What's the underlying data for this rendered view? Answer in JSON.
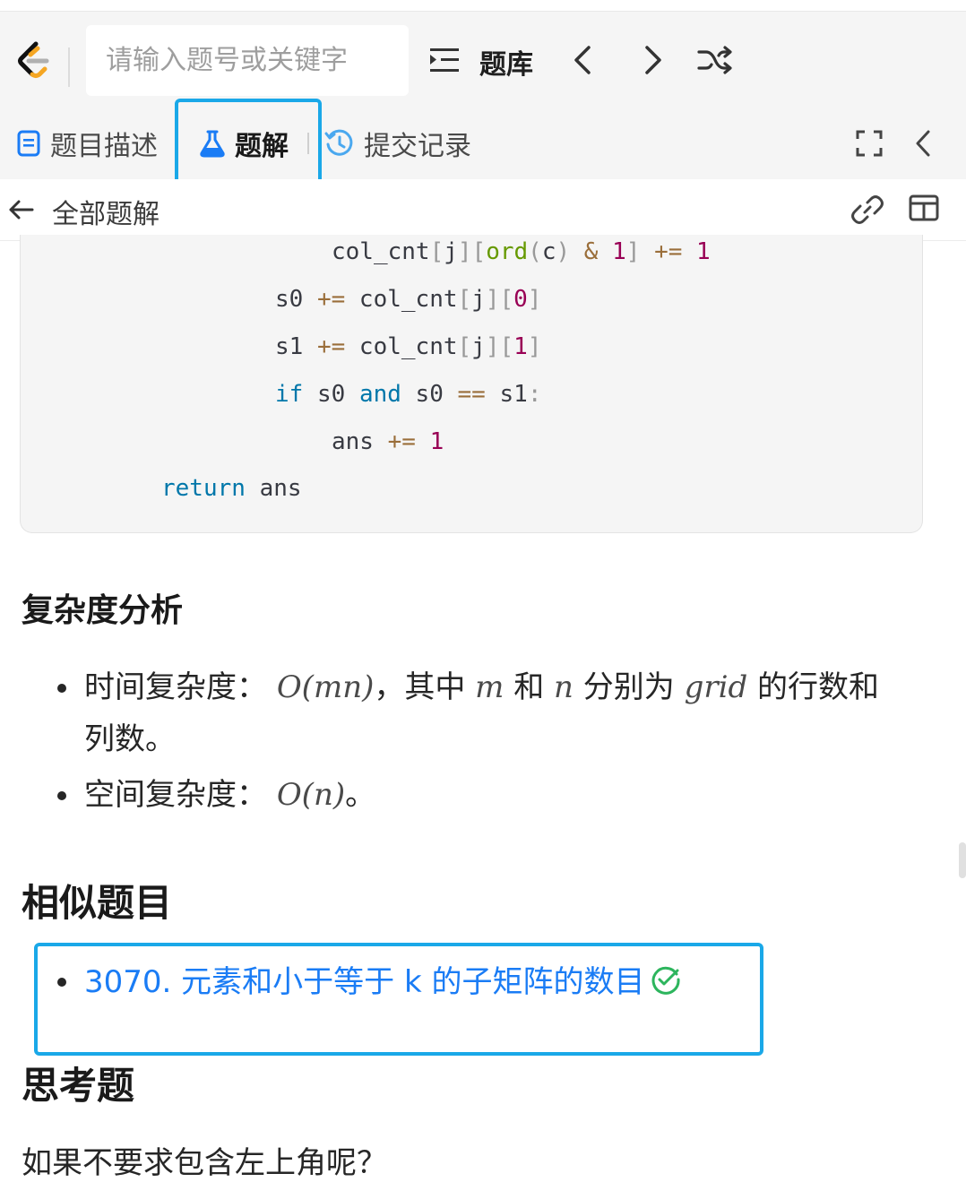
{
  "header": {
    "search_placeholder": "请输入题号或关键字",
    "problem_bank_label": "题库"
  },
  "tabs": [
    {
      "label": "题目描述"
    },
    {
      "label": "题解"
    },
    {
      "label": "提交记录"
    }
  ],
  "breadcrumb": {
    "back_label": "全部题解"
  },
  "code": {
    "lines": [
      "col_cnt[j][ord(c) & 1] += 1",
      "s0 += col_cnt[j][0]",
      "s1 += col_cnt[j][1]",
      "if s0 and s0 == s1:",
      "ans += 1",
      "return ans"
    ]
  },
  "complexity": {
    "heading": "复杂度分析",
    "time_prefix": "时间复杂度：",
    "time_big_o": "O(mn)",
    "time_mid1": "，其中",
    "var_m": "m",
    "time_and": "和",
    "var_n": "n",
    "time_mid2": "分别为",
    "var_grid": "grid",
    "time_suffix": "的行数和",
    "time_wrap": "列数。",
    "space_prefix": "空间复杂度：",
    "space_big_o": "O(n)",
    "space_suffix": "。"
  },
  "similar": {
    "heading": "相似题目",
    "items": [
      {
        "title": "3070. 元素和小于等于 k 的子矩阵的数目",
        "solved": true
      }
    ]
  },
  "thinking": {
    "heading": "思考题",
    "question": "如果不要求包含左上角呢？"
  },
  "colors": {
    "accent_blue": "#1a7cf5",
    "highlight_border": "#1aa8e8",
    "solved_green": "#2db55d"
  }
}
